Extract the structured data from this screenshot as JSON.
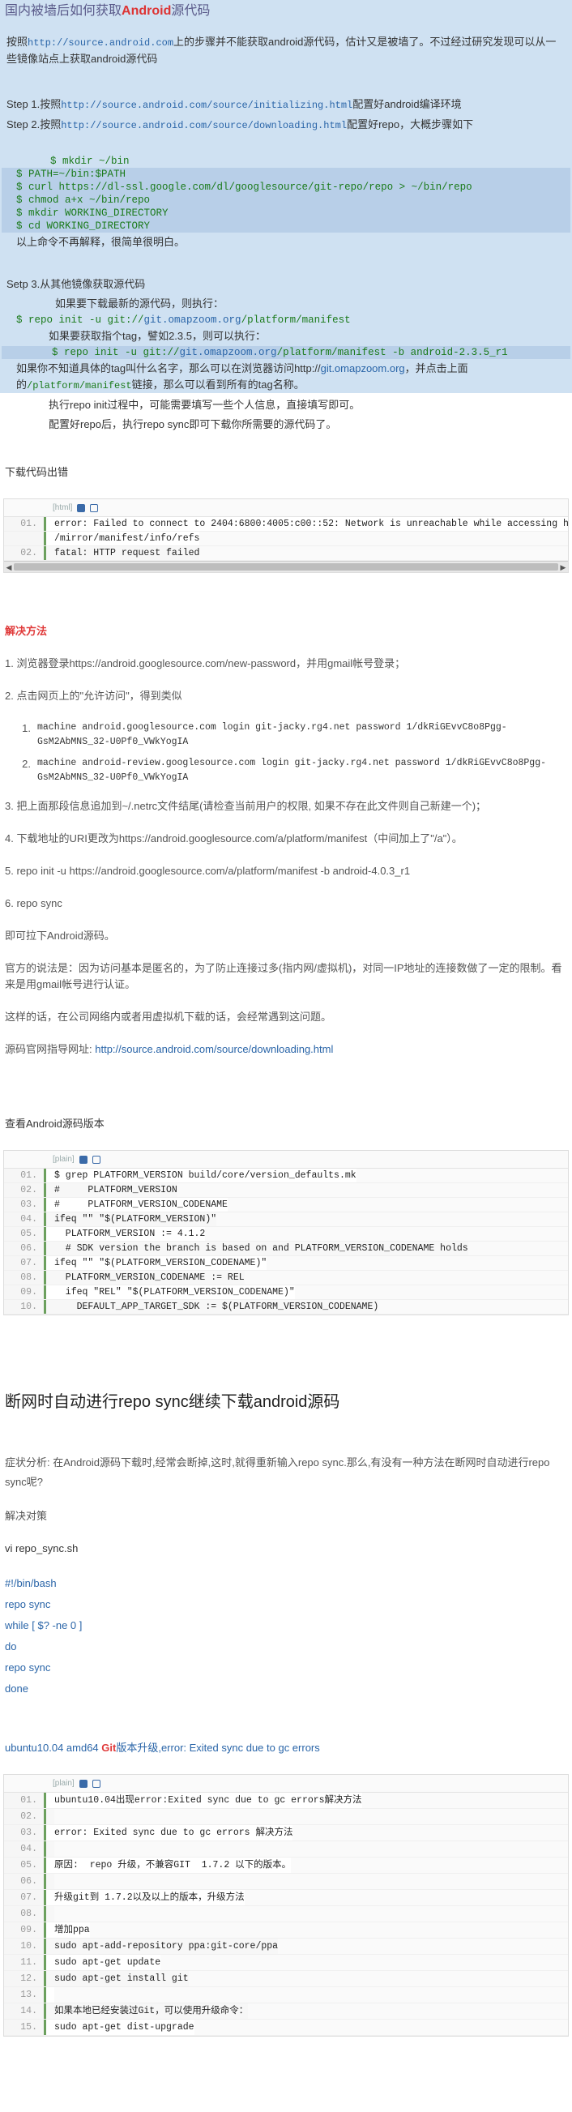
{
  "header": {
    "title_pre": "国内被墙后如何获取",
    "title_bold": "Android",
    "title_post": "源代码",
    "intro_a": "按照",
    "intro_url": "http://source.android.com",
    "intro_b": "上的步骤并不能获取android源代码，估计又是被墙了。不过经过研究发现可以从一些镜像站点上获取android源代码",
    "step1_a": "Step 1.按照",
    "step1_url": "http://source.android.com/source/initializing.html",
    "step1_b": "配置好android编译环境",
    "step2_a": "Step 2.按照",
    "step2_url": "http://source.android.com/source/downloading.html",
    "step2_b": "配置好repo，大概步骤如下",
    "cmds": [
      "$ mkdir ~/bin",
      "$ PATH=~/bin:$PATH",
      "$ curl https://dl-ssl.google.com/dl/googlesource/git-repo/repo > ~/bin/repo",
      "$ chmod a+x ~/bin/repo",
      "$ mkdir WORKING_DIRECTORY",
      "$ cd WORKING_DIRECTORY"
    ],
    "note1": "以上命令不再解释，很简单很明白。",
    "step3": "Setp 3.从其他镜像获取源代码",
    "step3_a": "如果要下载最新的源代码，则执行：",
    "step3_cmd_a": "$ repo init -u git://",
    "step3_cmd_url": "git.omapzoom.org",
    "step3_cmd_b": "/platform/manifest",
    "step3_b": "如果要获取指个tag，譬如2.3.5，则可以执行：",
    "step3_cmd2_a": "$ repo init -u git://",
    "step3_cmd2_url": "git.omapzoom.org",
    "step3_cmd2_b": "/platform/manifest -b android-2.3.5_r1",
    "step3_c1": "如果你不知道具体的tag叫什么名字，那么可以在浏览器访问http://",
    "step3_c_url": "git.omapzoom.org",
    "step3_c2": "，并点击上面的",
    "step3_c3": "/platform/manifest",
    "step3_c4": "链接，那么可以看到所有的tag名称。",
    "step3_d": "执行repo init过程中，可能需要填写一些个人信息，直接填写即可。",
    "step3_e": "配置好repo后，执行repo sync即可下载你所需要的源代码了。"
  },
  "download_error": {
    "label": "下载代码出错",
    "toolbar_lang": "[html]",
    "lines": [
      {
        "n": "01.",
        "t": "error: Failed to connect to 2404:6800:4005:c00::52: Network is unreachable while accessing h"
      },
      {
        "n": "",
        "t": "/mirror/manifest/info/refs"
      },
      {
        "n": "02.",
        "t": "fatal: HTTP request failed"
      }
    ]
  },
  "solution": {
    "title": "解决方法",
    "s1": "1. 浏览器登录https://android.googlesource.com/new-password，并用gmail帐号登录；",
    "s2": "2. 点击网页上的\"允许访问\"，得到类似",
    "items": [
      {
        "n": "1.",
        "t": "machine  android.googlesource.com  login  git-jacky.rg4.net  password  1/dkRiGEvvC8o8Pgg-GsM2AbMNS_32-U0Pf0_VWkYogIA"
      },
      {
        "n": "2.",
        "t": "machine  android-review.googlesource.com  login  git-jacky.rg4.net  password  1/dkRiGEvvC8o8Pgg-GsM2AbMNS_32-U0Pf0_VWkYogIA"
      }
    ],
    "s3": "3. 把上面那段信息追加到~/.netrc文件结尾(请检查当前用户的权限, 如果不存在此文件则自己新建一个)；",
    "s4": "4. 下载地址的URI更改为https://android.googlesource.com/a/platform/manifest（中间加上了\"/a\"）。",
    "s5": "5. repo init -u https://android.googlesource.com/a/platform/manifest -b android-4.0.3_r1",
    "s6": "6. repo sync",
    "s7": "即可拉下Android源码。",
    "p1": "官方的说法是：因为访问基本是匿名的，为了防止连接过多(指内网/虚拟机)，对同一IP地址的连接数做了一定的限制。看来是用gmail帐号进行认证。",
    "p2": "这样的话，在公司网络内或者用虚拟机下载的话，会经常遇到这问题。",
    "p3_a": "源码官网指导网址: ",
    "p3_url": "http://source.android.com/source/downloading.html"
  },
  "version": {
    "label": "查看Android源码版本",
    "toolbar_lang": "[plain]",
    "lines": [
      {
        "n": "01.",
        "t": "$ grep PLATFORM_VERSION build/core/version_defaults.mk"
      },
      {
        "n": "02.",
        "t": "#     PLATFORM_VERSION"
      },
      {
        "n": "03.",
        "t": "#     PLATFORM_VERSION_CODENAME"
      },
      {
        "n": "04.",
        "t": "ifeq \"\" \"$(PLATFORM_VERSION)\""
      },
      {
        "n": "05.",
        "t": "  PLATFORM_VERSION := 4.1.2"
      },
      {
        "n": "06.",
        "t": "  # SDK version the branch is based on and PLATFORM_VERSION_CODENAME holds"
      },
      {
        "n": "07.",
        "t": "ifeq \"\" \"$(PLATFORM_VERSION_CODENAME)\""
      },
      {
        "n": "08.",
        "t": "  PLATFORM_VERSION_CODENAME := REL"
      },
      {
        "n": "09.",
        "t": "  ifeq \"REL\" \"$(PLATFORM_VERSION_CODENAME)\""
      },
      {
        "n": "10.",
        "t": "    DEFAULT_APP_TARGET_SDK := $(PLATFORM_VERSION_CODENAME)"
      }
    ]
  },
  "autosync": {
    "title": "断网时自动进行repo sync继续下载android源码",
    "p1": "症状分析: 在Android源码下载时,经常会断掉,这时,就得重新输入repo sync.那么,有没有一种方法在断网时自动进行repo sync呢?",
    "p2": "解决对策",
    "p3": "vi  repo_sync.sh",
    "script": [
      "#!/bin/bash",
      "repo sync",
      "while [ $? -ne 0 ]",
      "do",
      "repo sync",
      "done"
    ]
  },
  "ubuntu": {
    "title_a": "ubuntu10.04 amd64 ",
    "title_git": "Git",
    "title_b": "版本升级,error: Exited sync due to gc errors",
    "toolbar_lang": "[plain]",
    "lines": [
      {
        "n": "01.",
        "t": "ubuntu10.04出现error:Exited sync due to gc errors解决方法"
      },
      {
        "n": "02.",
        "t": ""
      },
      {
        "n": "03.",
        "t": "error: Exited sync due to gc errors 解决方法"
      },
      {
        "n": "04.",
        "t": ""
      },
      {
        "n": "05.",
        "t": "原因:  repo 升级，不兼容GIT  1.7.2 以下的版本。"
      },
      {
        "n": "06.",
        "t": ""
      },
      {
        "n": "07.",
        "t": "升级git到 1.7.2以及以上的版本，升级方法"
      },
      {
        "n": "08.",
        "t": ""
      },
      {
        "n": "09.",
        "t": "增加ppa"
      },
      {
        "n": "10.",
        "t": "sudo apt-add-repository ppa:git-core/ppa"
      },
      {
        "n": "11.",
        "t": "sudo apt-get update"
      },
      {
        "n": "12.",
        "t": "sudo apt-get install git"
      },
      {
        "n": "13.",
        "t": ""
      },
      {
        "n": "14.",
        "t": "如果本地已经安装过Git，可以使用升级命令："
      },
      {
        "n": "15.",
        "t": "sudo apt-get dist-upgrade"
      }
    ]
  }
}
